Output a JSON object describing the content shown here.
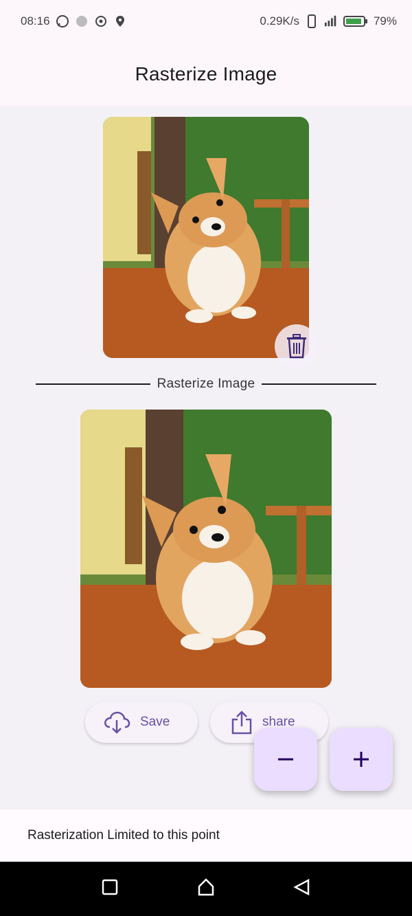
{
  "status_bar": {
    "time": "08:16",
    "network_speed": "0.29K/s",
    "battery": "79%",
    "icons": [
      "whatsapp-icon",
      "circle-icon",
      "target-icon",
      "location-icon",
      "phone-icon",
      "signal-icon",
      "battery-icon"
    ]
  },
  "app_bar": {
    "title": "Rasterize Image"
  },
  "divider": {
    "label": "Rasterize Image"
  },
  "actions": {
    "save_label": "Save",
    "share_label": "share"
  },
  "fab": {
    "minus_symbol": "−",
    "plus_symbol": "+"
  },
  "footer": {
    "message": "Rasterization Limited to this point"
  },
  "colors": {
    "accent": "#6750a4",
    "fab_bg": "#eaddff",
    "app_bg": "#fdf7fb"
  },
  "nav": {
    "icons": [
      "recents-square-icon",
      "home-icon",
      "back-triangle-icon"
    ]
  }
}
